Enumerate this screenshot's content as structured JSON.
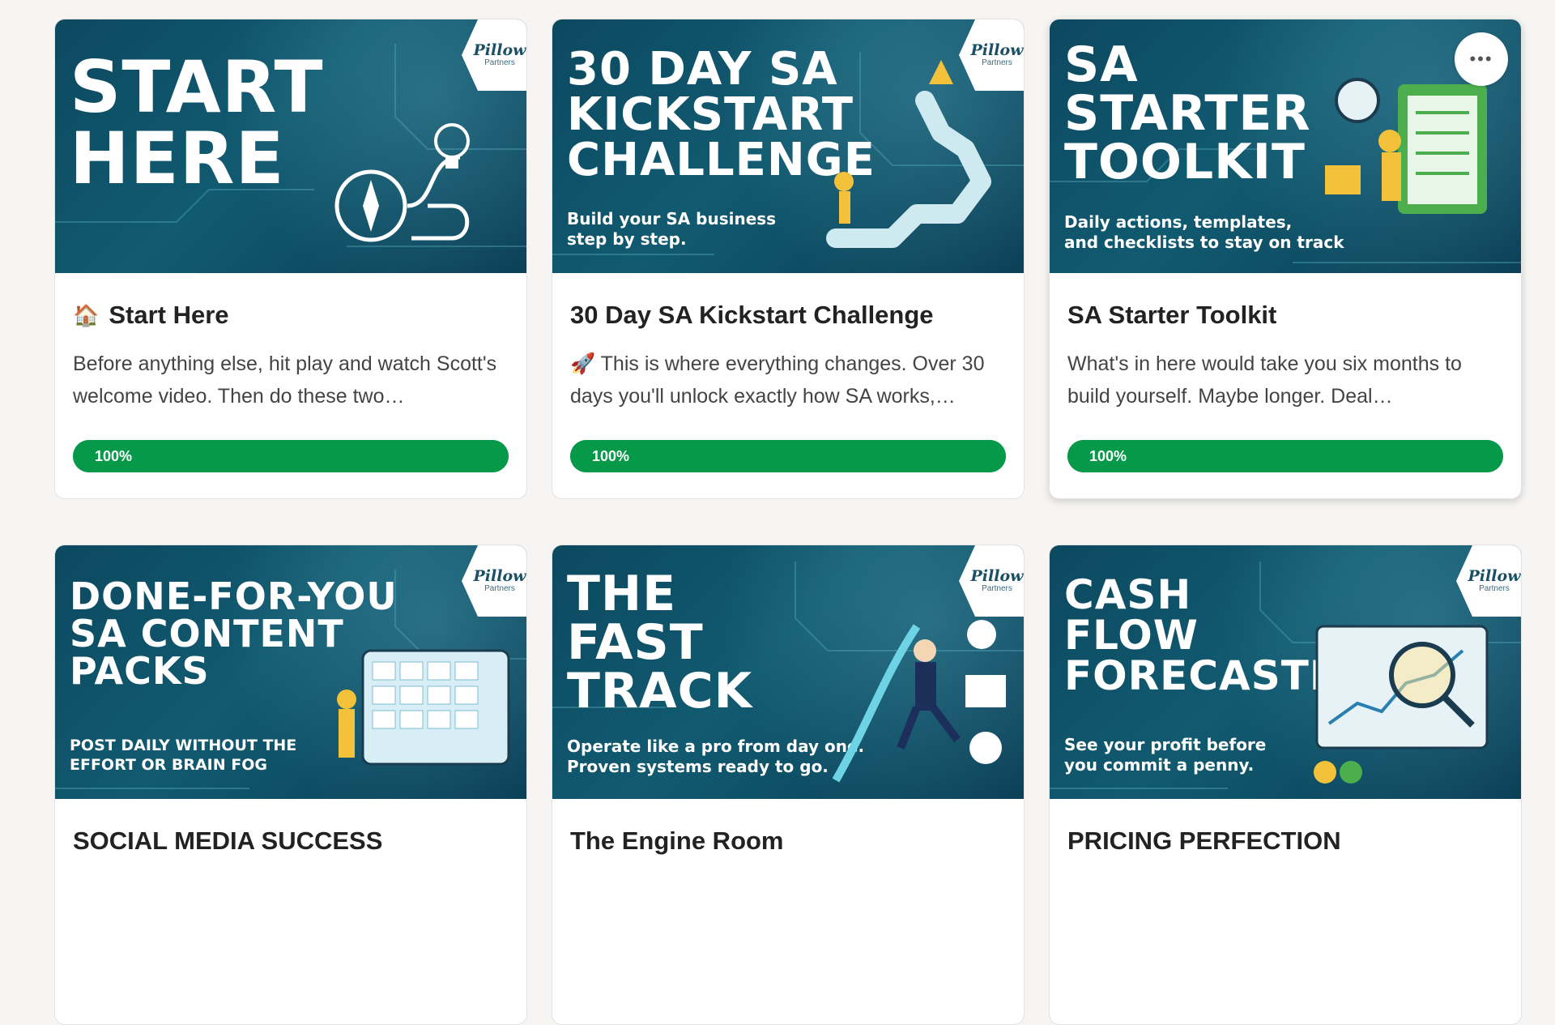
{
  "courses": [
    {
      "image_title": "START\nHERE",
      "image_subtitle": "",
      "title": "Start Here",
      "title_icon": "🏠",
      "description": "Before anything else, hit play and watch Scott's welcome video. Then do these two…",
      "progress_label": "100%",
      "progress": 1.0
    },
    {
      "image_title": "30 DAY SA\nKICKSTART\nCHALLENGE",
      "image_subtitle": "Build your SA business\nstep by step.",
      "title": "30 Day SA Kickstart Challenge",
      "title_icon": "",
      "description_icon": "🚀",
      "description": "This is where everything changes. Over 30 days you'll unlock exactly how SA works,…",
      "progress_label": "100%",
      "progress": 1.0
    },
    {
      "image_title": "SA\nSTARTER\nTOOLKIT",
      "image_subtitle": "Daily actions, templates,\nand checklists to stay on track",
      "title": "SA Starter Toolkit",
      "title_icon": "",
      "description": "What's in here would take you six months to build yourself. Maybe longer. Deal…",
      "progress_label": "100%",
      "progress": 1.0
    },
    {
      "image_title": "DONE-FOR-YOU\nSA CONTENT\nPACKS",
      "image_subtitle": "POST DAILY WITHOUT THE\nEFFORT OR BRAIN FOG",
      "title": "SOCIAL MEDIA SUCCESS"
    },
    {
      "image_title": "THE\nFAST\nTRACK",
      "image_subtitle": "Operate like a pro from day one.\nProven systems ready to go.",
      "title": "The Engine Room"
    },
    {
      "image_title": "CASH\nFLOW\nFORECASTER",
      "image_subtitle": "See your profit before\nyou commit a penny.",
      "title": "PRICING PERFECTION"
    }
  ],
  "logo": {
    "main": "Pillow",
    "sub": "Partners"
  },
  "more_button": {
    "icon": "more-horizontal-icon",
    "glyph": "•••"
  },
  "colors": {
    "progress": "#07994a",
    "card_image_bg": "#0c4960"
  }
}
